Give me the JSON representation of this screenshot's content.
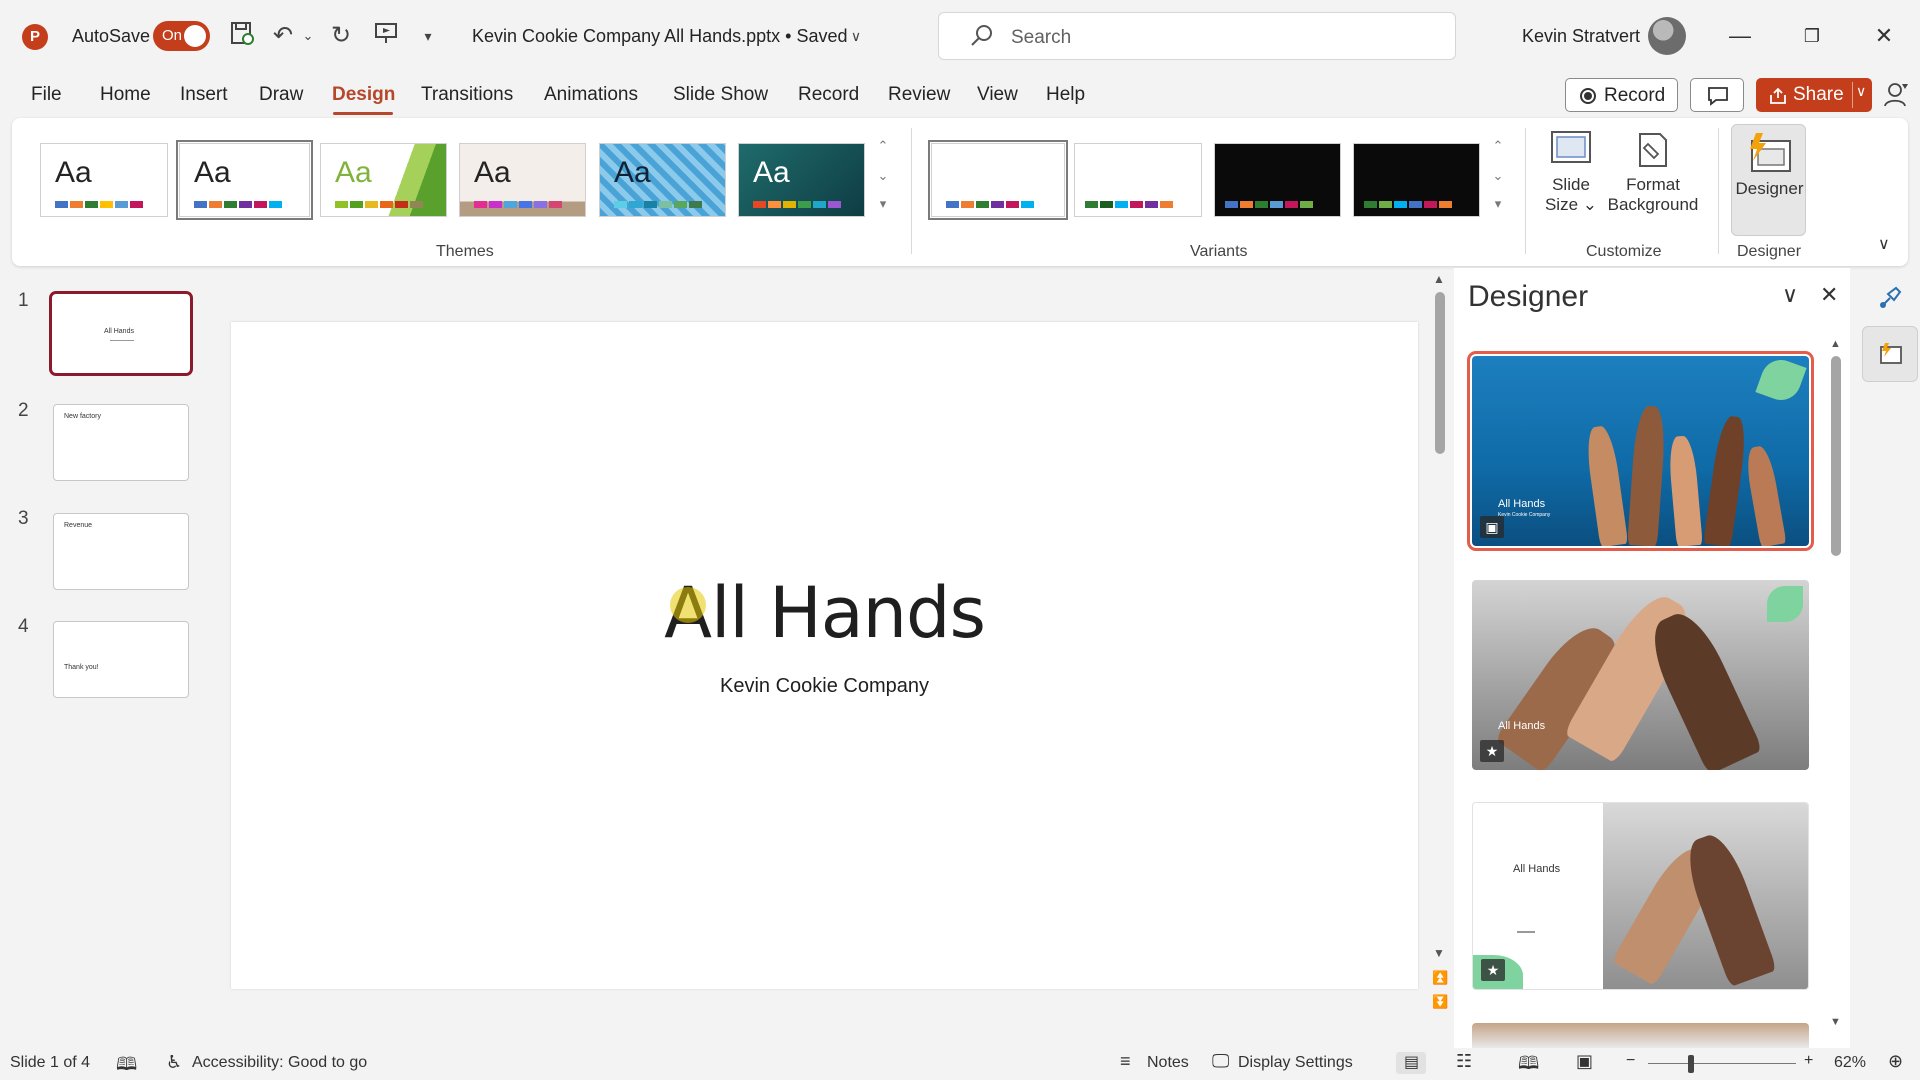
{
  "app": {
    "logo_letter": "P",
    "autosave_label": "AutoSave",
    "autosave_state": "On",
    "document_title": "Kevin Cookie Company All Hands.pptx • Saved",
    "search_placeholder": "Search",
    "user_name": "Kevin Stratvert",
    "brand_color": "#c43e1c"
  },
  "menu": {
    "items": [
      "File",
      "Home",
      "Insert",
      "Draw",
      "Design",
      "Transitions",
      "Animations",
      "Slide Show",
      "Record",
      "Review",
      "View",
      "Help"
    ],
    "active": "Design",
    "record_label": "Record",
    "share_label": "Share"
  },
  "ribbon": {
    "themes_label": "Themes",
    "variants_label": "Variants",
    "customize_label": "Customize",
    "designer_group_label": "Designer",
    "theme_aa": "Aa",
    "slide_size_label_1": "Slide",
    "slide_size_label_2": "Size",
    "format_bg_label_1": "Format",
    "format_bg_label_2": "Background",
    "designer_button_label": "Designer"
  },
  "slides": [
    {
      "number": "1",
      "title": "All Hands"
    },
    {
      "number": "2",
      "title": "New factory"
    },
    {
      "number": "3",
      "title": "Revenue"
    },
    {
      "number": "4",
      "title": "Thank you!"
    }
  ],
  "current_slide": {
    "title": "All Hands",
    "subtitle": "Kevin Cookie Company"
  },
  "designer_pane": {
    "title": "Designer",
    "ideas": [
      {
        "label": "All Hands",
        "sublabel": "Kevin Cookie Company"
      },
      {
        "label": "All Hands"
      },
      {
        "label": "All Hands"
      }
    ]
  },
  "status": {
    "slide_info": "Slide 1 of 4",
    "accessibility": "Accessibility: Good to go",
    "notes": "Notes",
    "display_settings": "Display Settings",
    "zoom": "62%"
  }
}
